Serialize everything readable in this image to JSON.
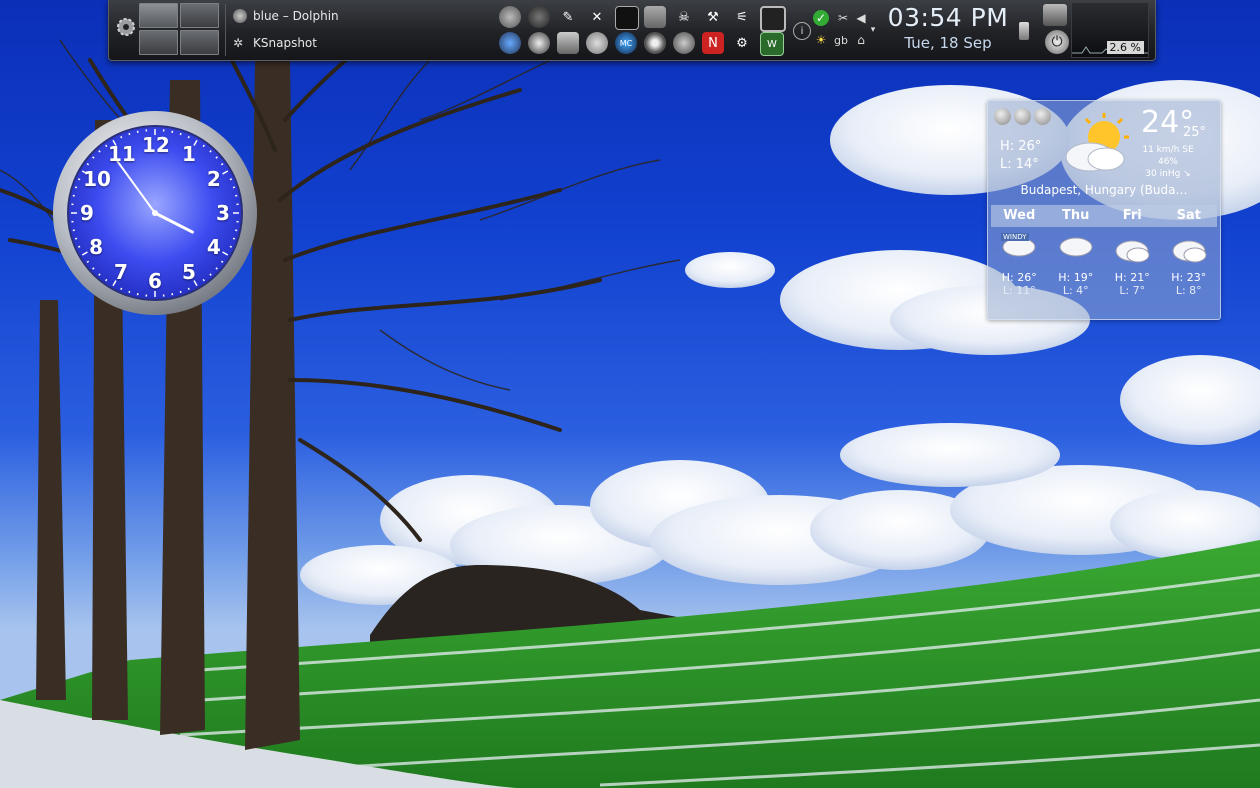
{
  "panel": {
    "tasks": [
      {
        "label": "blue – Dolphin",
        "icon": "dolphin-icon"
      },
      {
        "label": "KSnapshot",
        "icon": "ksnapshot-icon"
      }
    ],
    "pager_desktops": 4,
    "launchers": [
      "disks-icon",
      "sphere-icon",
      "brush-icon",
      "tools-icon",
      "terminal-icon",
      "folder-icon",
      "skull-icon",
      "hammer-icon",
      "screwdriver-icon",
      "window-icon",
      "magnifier-icon",
      "media-icon",
      "clipboard-icon",
      "globe-icon",
      "mc-icon",
      "disc-icon",
      "beach-icon",
      "burn-icon",
      "chip-icon",
      "monitor-icon"
    ],
    "tray": {
      "info_icon": "info-icon",
      "check_icon": "check-icon",
      "scissors_icon": "scissors-icon",
      "volume_icon": "volume-icon",
      "weather_icon": "sun-cloud-icon",
      "keyboard_layout": "gb",
      "usb_icon": "usb-icon"
    },
    "clock": {
      "time": "03:54 PM",
      "date": "Tue, 18 Sep"
    },
    "cpu": {
      "label": "2.6 %"
    }
  },
  "analog_clock": {
    "numbers": [
      "12",
      "1",
      "2",
      "3",
      "4",
      "5",
      "6",
      "7",
      "8",
      "9",
      "10",
      "11"
    ],
    "hour": 3,
    "minute": 54
  },
  "weather": {
    "today": {
      "high": "H: 26°",
      "low": "L: 14°",
      "temp": "24°",
      "feels": "25°"
    },
    "wind": "11 km/h SE",
    "humidity": "46%",
    "pressure": "30 inHg ↘",
    "location": "Budapest, Hungary (Buda…",
    "forecast": [
      {
        "day": "Wed",
        "high": "H: 26°",
        "low": "L: 11°",
        "tag": "WINDY"
      },
      {
        "day": "Thu",
        "high": "H: 19°",
        "low": "L: 4°",
        "tag": ""
      },
      {
        "day": "Fri",
        "high": "H: 21°",
        "low": "L: 7°",
        "tag": ""
      },
      {
        "day": "Sat",
        "high": "H: 23°",
        "low": "L: 8°",
        "tag": ""
      }
    ]
  },
  "colors": {
    "sky": "#1242d0",
    "grass": "#2f9a2a",
    "clock_face": "#3a45e8",
    "panel": "#202226"
  }
}
